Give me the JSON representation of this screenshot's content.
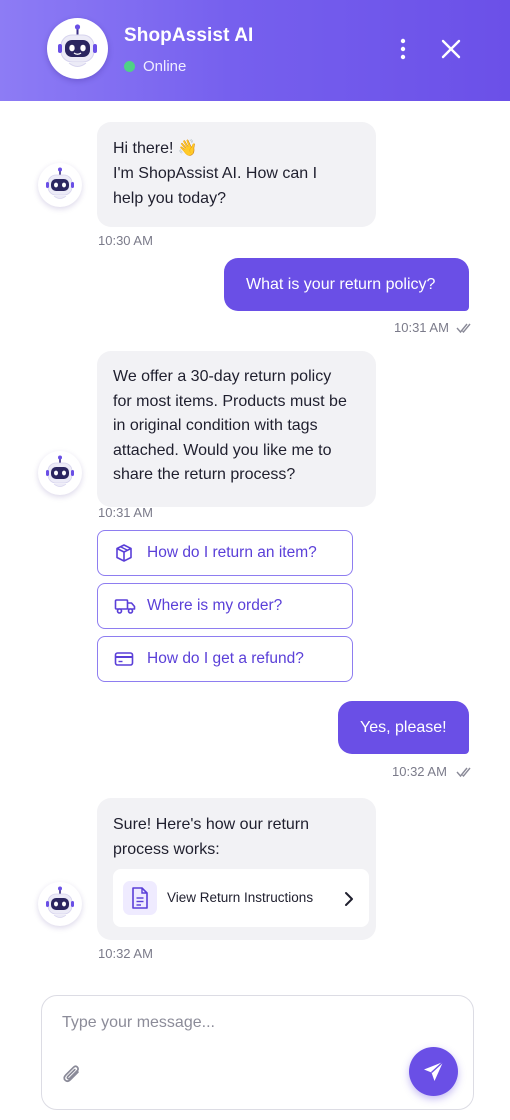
{
  "header": {
    "title": "ShopAssist AI",
    "status": "Online"
  },
  "messages": [
    {
      "sender": "bot",
      "lines": [
        "Hi there! 👋",
        "I'm ShopAssist AI. How can I",
        "help you today?"
      ],
      "time": "10:30 AM"
    },
    {
      "sender": "user",
      "text": "What is your return policy?",
      "time": "10:31 AM"
    },
    {
      "sender": "bot",
      "lines": [
        "We offer a 30-day return policy",
        "for most items. Products must be",
        "in original condition with tags",
        "attached. Would you like me to",
        "share the return process?"
      ],
      "time": "10:31 AM"
    },
    {
      "sender": "user",
      "text": "Yes, please!",
      "time": "10:32 AM"
    },
    {
      "sender": "bot",
      "lines": [
        "Sure! Here's how our return",
        "process works:"
      ],
      "time": "10:32 AM"
    }
  ],
  "quick_replies": [
    {
      "label": "How do I return an item?",
      "icon": "package-icon"
    },
    {
      "label": "Where is my order?",
      "icon": "truck-icon"
    },
    {
      "label": "How do I get a refund?",
      "icon": "credit-card-icon"
    }
  ],
  "instructions_card": {
    "label": "View Return Instructions",
    "icon": "document-icon"
  },
  "composer": {
    "placeholder": "Type your message..."
  },
  "colors": {
    "accent": "#6a4fe6",
    "online": "#4fd186",
    "bot_bubble": "#f2f2f5"
  }
}
